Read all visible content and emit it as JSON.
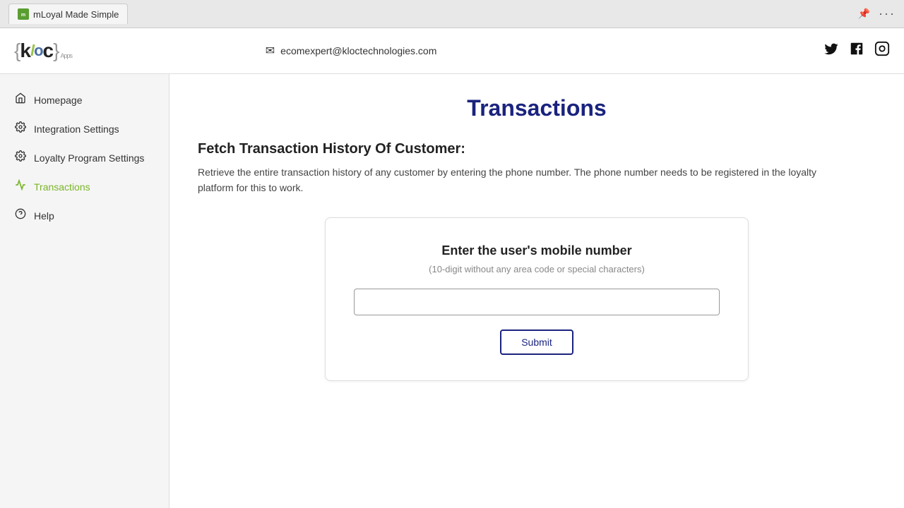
{
  "browser": {
    "tab_label": "mLoyal Made Simple",
    "pin_icon": "📌",
    "more_icon": "···"
  },
  "header": {
    "logo_text": "{kloc}",
    "logo_apps": "Apps",
    "email": "ecomexpert@kloctechnologies.com",
    "social": [
      "twitter",
      "facebook",
      "instagram"
    ]
  },
  "sidebar": {
    "items": [
      {
        "id": "homepage",
        "label": "Homepage",
        "icon": "home",
        "active": false
      },
      {
        "id": "integration-settings",
        "label": "Integration Settings",
        "icon": "gear",
        "active": false
      },
      {
        "id": "loyalty-program-settings",
        "label": "Loyalty Program Settings",
        "icon": "gear",
        "active": false
      },
      {
        "id": "transactions",
        "label": "Transactions",
        "icon": "chart",
        "active": true
      },
      {
        "id": "help",
        "label": "Help",
        "icon": "info",
        "active": false
      }
    ]
  },
  "main": {
    "page_title": "Transactions",
    "section_heading": "Fetch Transaction History Of Customer:",
    "section_description": "Retrieve the entire transaction history of any customer by entering the phone number. The phone number needs to be registered in the loyalty platform for this to work.",
    "card": {
      "title": "Enter the user's mobile number",
      "subtitle": "(10-digit without any area code or special characters)",
      "input_placeholder": "",
      "submit_label": "Submit"
    }
  }
}
